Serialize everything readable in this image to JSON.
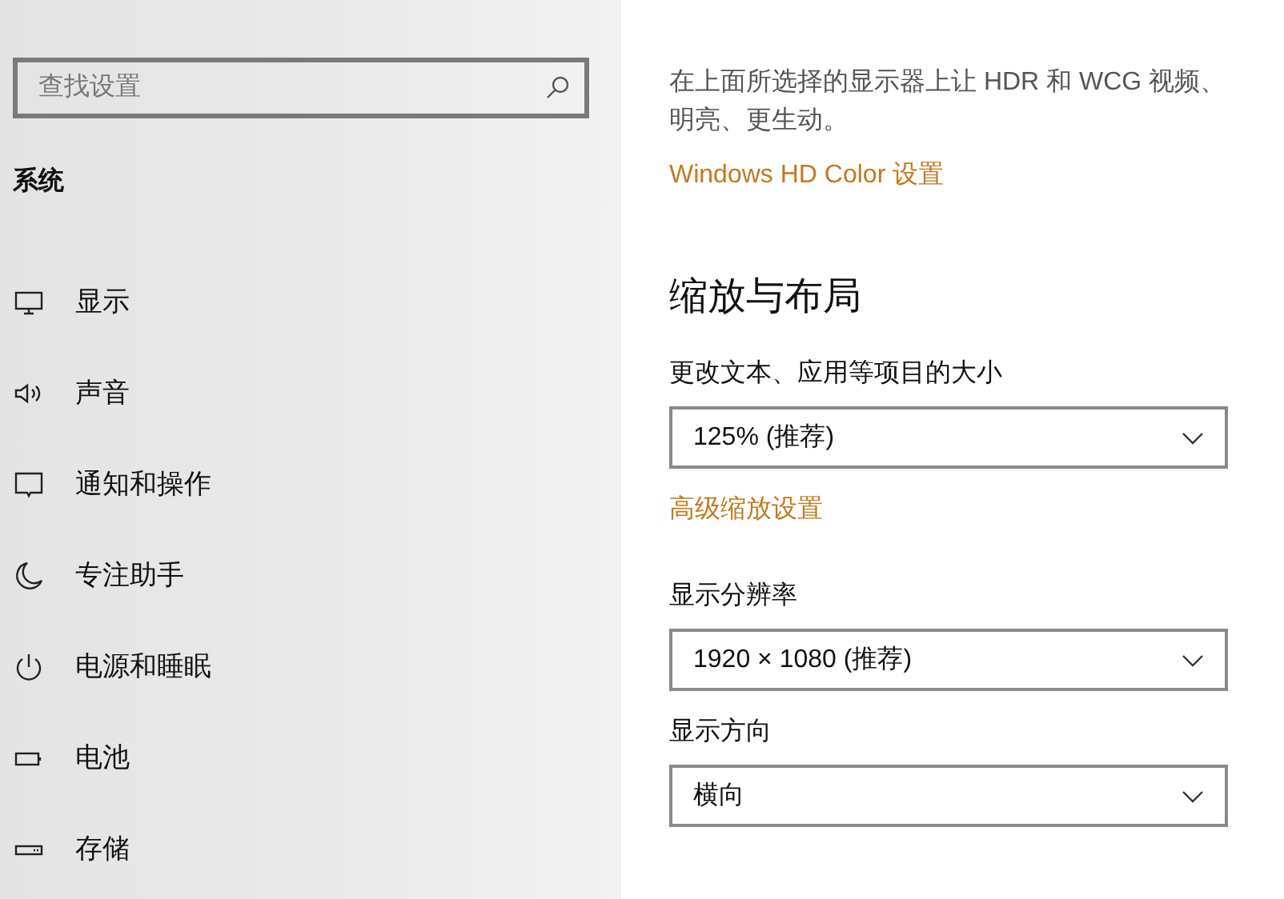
{
  "sidebar": {
    "search": {
      "placeholder": "查找设置"
    },
    "section_title": "系统",
    "items": [
      {
        "label": "显示"
      },
      {
        "label": "声音"
      },
      {
        "label": "通知和操作"
      },
      {
        "label": "专注助手"
      },
      {
        "label": "电源和睡眠"
      },
      {
        "label": "电池"
      },
      {
        "label": "存储"
      }
    ]
  },
  "content": {
    "description_lines": [
      "在上面所选择的显示器上让 HDR 和 WCG 视频、",
      "明亮、更生动。"
    ],
    "hd_color_link": "Windows HD Color 设置",
    "section_title": "缩放与布局",
    "settings": [
      {
        "kind": "dropdown",
        "label": "更改文本、应用等项目的大小",
        "value": "125% (推荐)"
      },
      {
        "kind": "link",
        "label": "高级缩放设置"
      },
      {
        "kind": "dropdown",
        "label": "显示分辨率",
        "value": "1920 × 1080 (推荐)"
      },
      {
        "kind": "dropdown",
        "label": "显示方向",
        "value": "横向"
      }
    ]
  }
}
